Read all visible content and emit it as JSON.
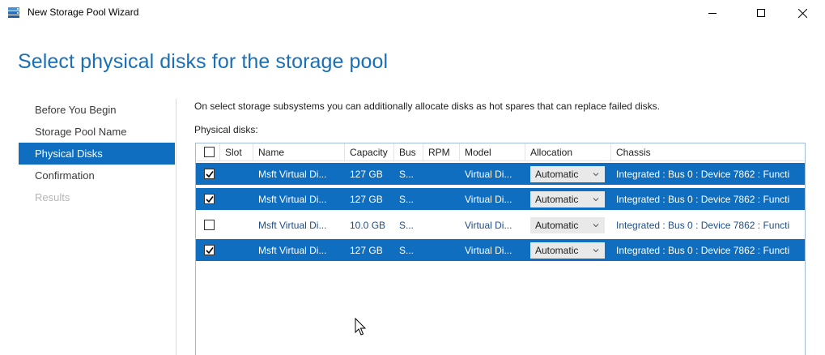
{
  "window": {
    "title": "New Storage Pool Wizard"
  },
  "page_title": "Select physical disks for the storage pool",
  "nav": {
    "items": [
      {
        "label": "Before You Begin",
        "state": "normal"
      },
      {
        "label": "Storage Pool Name",
        "state": "normal"
      },
      {
        "label": "Physical Disks",
        "state": "selected"
      },
      {
        "label": "Confirmation",
        "state": "normal"
      },
      {
        "label": "Results",
        "state": "disabled"
      }
    ]
  },
  "description": "On select storage subsystems you can additionally allocate disks as hot spares that can replace failed disks.",
  "disks_label": "Physical disks:",
  "table": {
    "columns": [
      "",
      "Slot",
      "Name",
      "Capacity",
      "Bus",
      "RPM",
      "Model",
      "Allocation",
      "Chassis"
    ],
    "rows": [
      {
        "checked": true,
        "slot": "",
        "name": "Msft Virtual Di...",
        "capacity": "127 GB",
        "bus": "S...",
        "rpm": "",
        "model": "Virtual Di...",
        "allocation": "Automatic",
        "chassis": "Integrated : Bus 0 : Device 7862 : Functi"
      },
      {
        "checked": true,
        "slot": "",
        "name": "Msft Virtual Di...",
        "capacity": "127 GB",
        "bus": "S...",
        "rpm": "",
        "model": "Virtual Di...",
        "allocation": "Automatic",
        "chassis": "Integrated : Bus 0 : Device 7862 : Functi"
      },
      {
        "checked": false,
        "slot": "",
        "name": "Msft Virtual Di...",
        "capacity": "10.0 GB",
        "bus": "S...",
        "rpm": "",
        "model": "Virtual Di...",
        "allocation": "Automatic",
        "chassis": "Integrated : Bus 0 : Device 7862 : Functi"
      },
      {
        "checked": true,
        "slot": "",
        "name": "Msft Virtual Di...",
        "capacity": "127 GB",
        "bus": "S...",
        "rpm": "",
        "model": "Virtual Di...",
        "allocation": "Automatic",
        "chassis": "Integrated : Bus 0 : Device 7862 : Functi"
      }
    ]
  },
  "colors": {
    "accent": "#0f6ebf",
    "title": "#1a6fb5",
    "disabled_text": "#b6b6b6"
  }
}
